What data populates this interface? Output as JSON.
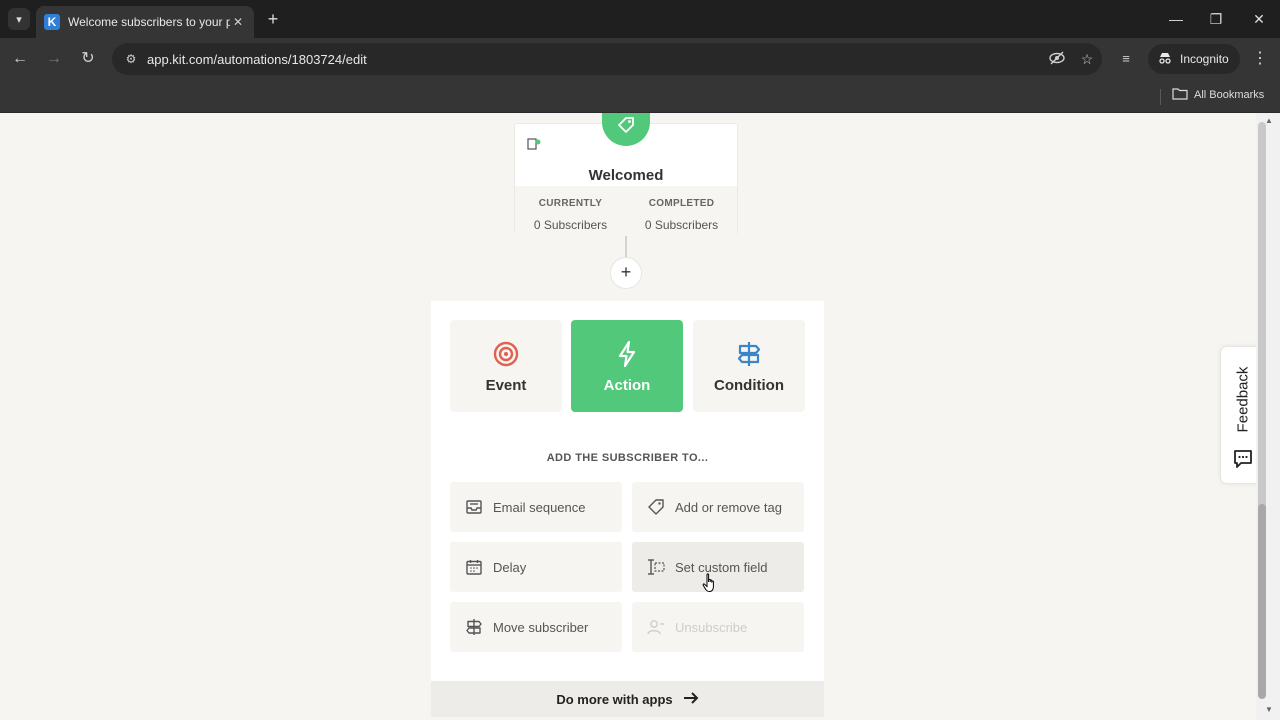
{
  "browser": {
    "tab_title": "Welcome subscribers to your p",
    "tab_favicon_letter": "K",
    "url": "app.kit.com/automations/1803724/edit",
    "incognito_label": "Incognito",
    "bookmarks_label": "All Bookmarks"
  },
  "step": {
    "title": "Welcomed",
    "currently_label": "CURRENTLY",
    "currently_value": "0 Subscribers",
    "completed_label": "COMPLETED",
    "completed_value": "0 Subscribers"
  },
  "panel": {
    "types": [
      {
        "label": "Event",
        "icon": "target-icon"
      },
      {
        "label": "Action",
        "icon": "lightning-icon",
        "active": true
      },
      {
        "label": "Condition",
        "icon": "signpost-icon"
      }
    ],
    "section_title": "ADD THE SUBSCRIBER TO...",
    "options": [
      {
        "label": "Email sequence",
        "icon": "inbox-icon"
      },
      {
        "label": "Add or remove tag",
        "icon": "tag-icon"
      },
      {
        "label": "Delay",
        "icon": "calendar-icon"
      },
      {
        "label": "Set custom field",
        "icon": "text-cursor-icon"
      },
      {
        "label": "Move subscriber",
        "icon": "signpost-icon"
      },
      {
        "label": "Unsubscribe",
        "icon": "user-remove-icon",
        "disabled": true
      }
    ],
    "apps_label": "Do more with apps"
  },
  "feedback": {
    "label": "Feedback"
  },
  "colors": {
    "brand_green": "#52c97a",
    "event_red": "#e0614f",
    "condition_blue": "#3a86c8",
    "page_bg": "#f7f5f2"
  }
}
